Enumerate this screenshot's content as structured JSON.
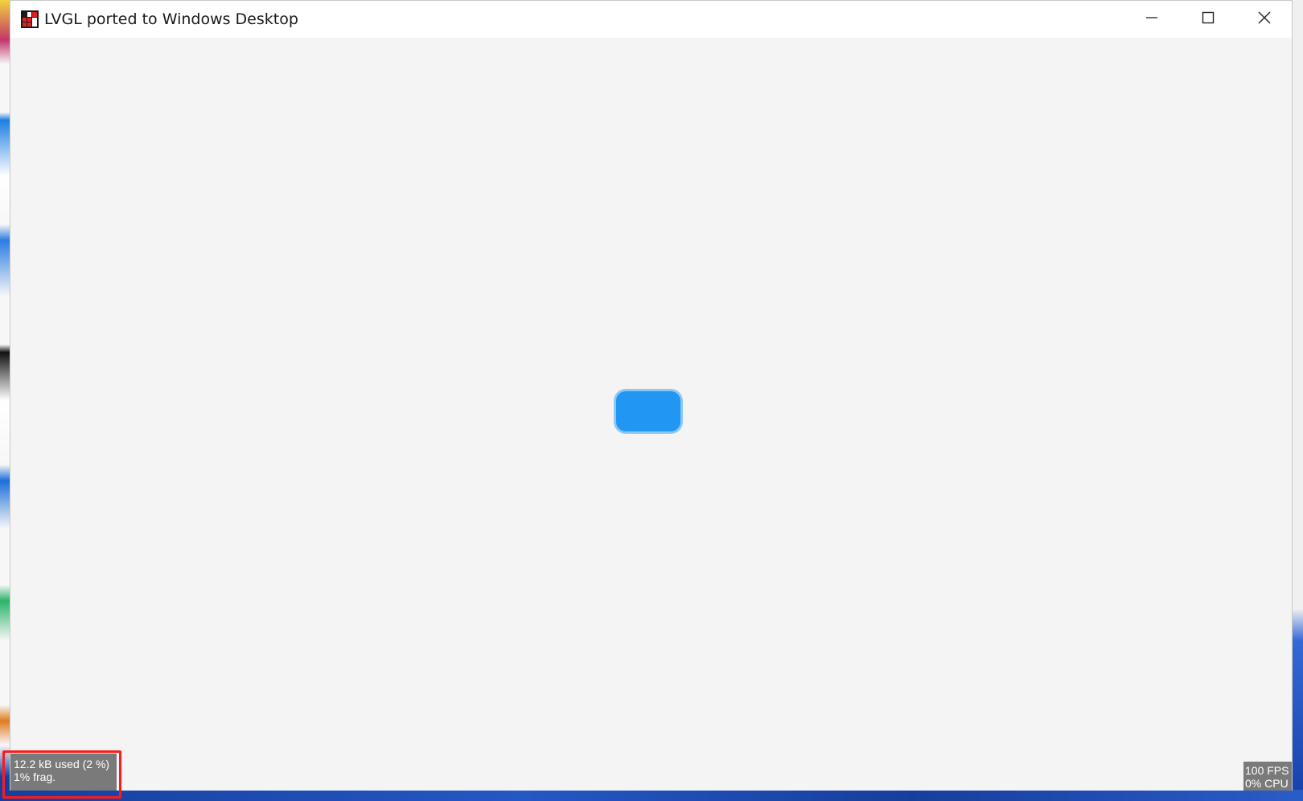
{
  "window": {
    "title": "LVGL ported to Windows Desktop",
    "controls": {
      "minimize_icon": "minimize-icon",
      "maximize_icon": "maximize-icon",
      "close_icon": "close-icon"
    }
  },
  "app": {
    "button_color": "#2196f3",
    "background_color": "#f4f4f4"
  },
  "perf_monitor": {
    "mem_used": "12.2 kB used (2 %)",
    "mem_frag": "1% frag.",
    "fps": "100 FPS",
    "cpu": "0% CPU"
  },
  "annotation": {
    "highlight_color": "#ff1a1a"
  }
}
